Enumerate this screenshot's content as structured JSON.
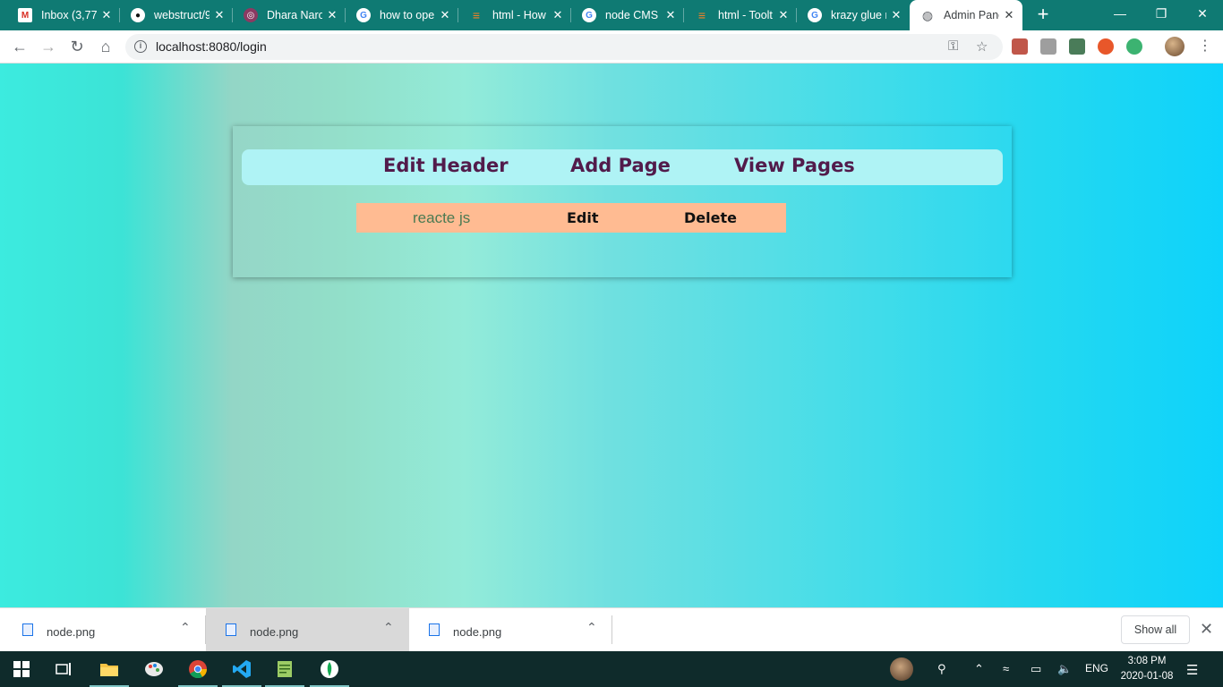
{
  "browser": {
    "tabs": [
      {
        "title": "Inbox (3,77",
        "icon": "gmail-icon",
        "color": "#d93025",
        "glyph": "M"
      },
      {
        "title": "webstruct/9",
        "icon": "github-icon",
        "color": "#111111",
        "glyph": "●"
      },
      {
        "title": "Dhara Naro",
        "icon": "profile-icon",
        "color": "#8b3a62",
        "glyph": "◎"
      },
      {
        "title": "how to ope",
        "icon": "google-icon",
        "color": "#ffffff",
        "glyph": "G"
      },
      {
        "title": "html - How",
        "icon": "stackoverflow-icon",
        "color": "#f48024",
        "glyph": "≡"
      },
      {
        "title": "node CMS",
        "icon": "google-icon",
        "color": "#ffffff",
        "glyph": "G"
      },
      {
        "title": "html - Toolt",
        "icon": "stackoverflow-icon",
        "color": "#f48024",
        "glyph": "≡"
      },
      {
        "title": "krazy glue r",
        "icon": "google-icon",
        "color": "#ffffff",
        "glyph": "G"
      },
      {
        "title": "Admin Pane",
        "icon": "globe-icon",
        "color": "#5f6368",
        "glyph": "◍"
      }
    ],
    "url": "localhost:8080/login"
  },
  "page": {
    "nav": {
      "edit_header": "Edit Header",
      "add_page": "Add Page",
      "view_pages": "View Pages"
    },
    "pages": [
      {
        "name": "reacte js",
        "edit": "Edit",
        "delete": "Delete"
      }
    ]
  },
  "downloads": {
    "items": [
      {
        "name": "node.png"
      },
      {
        "name": "node.png"
      },
      {
        "name": "node.png"
      }
    ],
    "show_all": "Show all"
  },
  "taskbar": {
    "lang": "ENG",
    "time": "3:08 PM",
    "date": "2020-01-08"
  },
  "colors": {
    "tabstrip": "#0f7a73",
    "nav_text": "#521b4b",
    "nav_bg": "#aff3f5",
    "row_bg": "#ffbb92"
  }
}
